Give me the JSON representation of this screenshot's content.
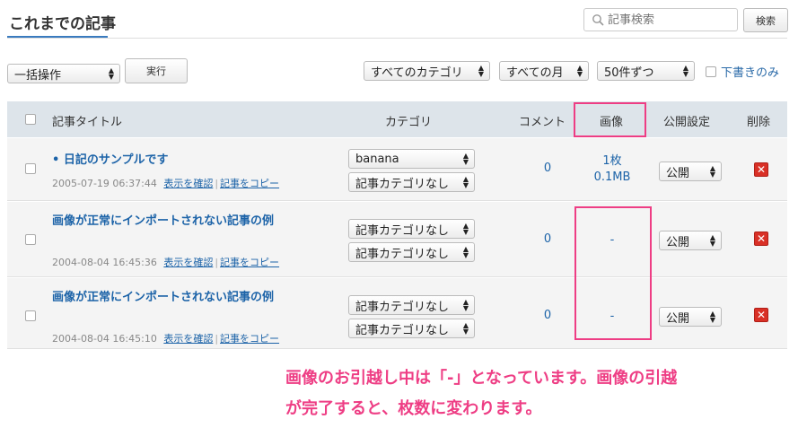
{
  "header": {
    "title": "これまでの記事",
    "search_placeholder": "記事検索",
    "search_button": "検索"
  },
  "toolbar": {
    "bulk_action": "一括操作",
    "execute": "実行",
    "category_filter": "すべてのカテゴリ",
    "month_filter": "すべての月",
    "per_page": "50件ずつ",
    "drafts_only": "下書きのみ"
  },
  "table": {
    "columns": {
      "title": "記事タイトル",
      "category": "カテゴリ",
      "comments": "コメント",
      "images": "画像",
      "publish": "公開設定",
      "delete": "削除"
    },
    "rows": [
      {
        "title": "• 日記のサンプルです",
        "date": "2005-07-19 06:37:44",
        "view_link": "表示を確認",
        "copy_link": "記事をコピー",
        "category1": "banana",
        "category2": "記事カテゴリなし",
        "comments": "0",
        "images_count": "1枚",
        "images_size": "0.1MB",
        "publish": "公開"
      },
      {
        "title": "画像が正常にインポートされない記事の例",
        "date": "2004-08-04 16:45:36",
        "view_link": "表示を確認",
        "copy_link": "記事をコピー",
        "category1": "記事カテゴリなし",
        "category2": "記事カテゴリなし",
        "comments": "0",
        "images_count": "-",
        "images_size": "",
        "publish": "公開"
      },
      {
        "title": "画像が正常にインポートされない記事の例",
        "date": "2004-08-04 16:45:10",
        "view_link": "表示を確認",
        "copy_link": "記事をコピー",
        "category1": "記事カテゴリなし",
        "category2": "記事カテゴリなし",
        "comments": "0",
        "images_count": "-",
        "images_size": "",
        "publish": "公開"
      }
    ]
  },
  "annotation": {
    "line1": "画像のお引越し中は「-」となっています。画像の引越",
    "line2": "が完了すると、枚数に変わります。"
  },
  "colors": {
    "link": "#1c63a8",
    "highlight": "#ee3d84",
    "header_bg": "#dde4ea",
    "delete": "#d93026"
  }
}
